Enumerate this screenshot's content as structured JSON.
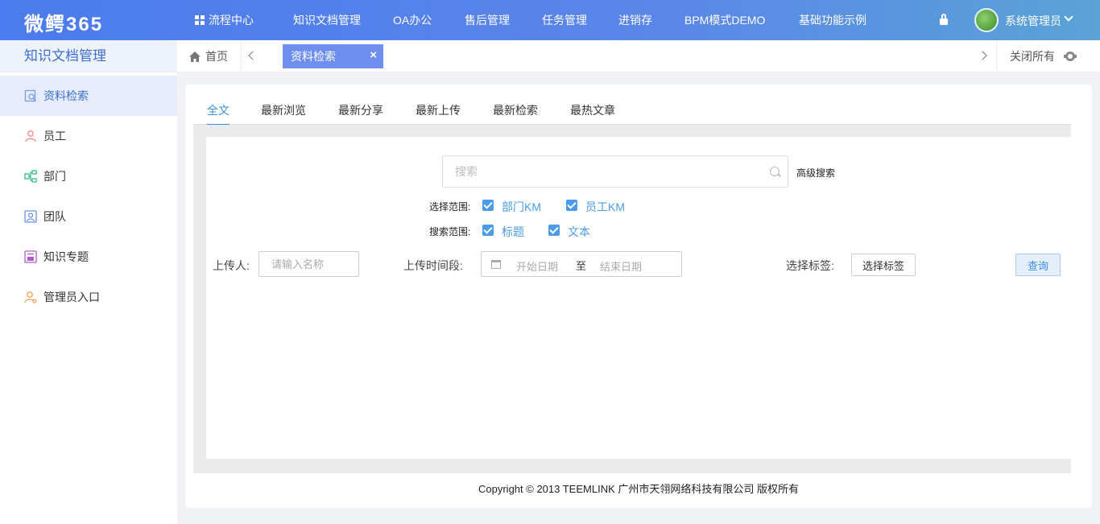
{
  "app": {
    "logo": "微鳄365"
  },
  "topnav": {
    "items": [
      "流程中心",
      "知识文档管理",
      "OA办公",
      "售后管理",
      "任务管理",
      "进销存",
      "BPM模式DEMO",
      "基础功能示例"
    ],
    "user_name": "系统管理员"
  },
  "sidebar": {
    "title": "知识文档管理",
    "items": [
      {
        "label": "资料检索",
        "icon": "search-doc-icon"
      },
      {
        "label": "员工",
        "icon": "person-icon"
      },
      {
        "label": "部门",
        "icon": "org-chart-icon"
      },
      {
        "label": "团队",
        "icon": "team-icon"
      },
      {
        "label": "知识专题",
        "icon": "topic-icon"
      },
      {
        "label": "管理员入口",
        "icon": "admin-icon"
      }
    ]
  },
  "tabs": {
    "home": "首页",
    "active": "资料检索",
    "close_all": "关闭所有"
  },
  "subtabs": [
    "全文",
    "最新浏览",
    "最新分享",
    "最新上传",
    "最新检索",
    "最热文章"
  ],
  "search": {
    "placeholder": "搜索",
    "advanced": "高级搜索",
    "scope_label": "选择范围:",
    "scope_options": [
      "部门KM",
      "员工KM"
    ],
    "search_scope_label": "搜索范围:",
    "search_scope_options": [
      "标题",
      "文本"
    ]
  },
  "form": {
    "uploader_label": "上传人:",
    "uploader_placeholder": "请输入名称",
    "time_label": "上传时间段:",
    "date_start": "开始日期",
    "date_sep": "至",
    "date_end": "结束日期",
    "tag_label": "选择标签:",
    "tag_button": "选择标签",
    "query_button": "查询"
  },
  "footer": {
    "copyright": "Copyright © 2013 TEEMLINK 广州市天翎网络科技有限公司 版权所有"
  },
  "colors": {
    "accent": "#4b7bec",
    "link": "#3d8fe0",
    "checkbox": "#4a9be9"
  }
}
